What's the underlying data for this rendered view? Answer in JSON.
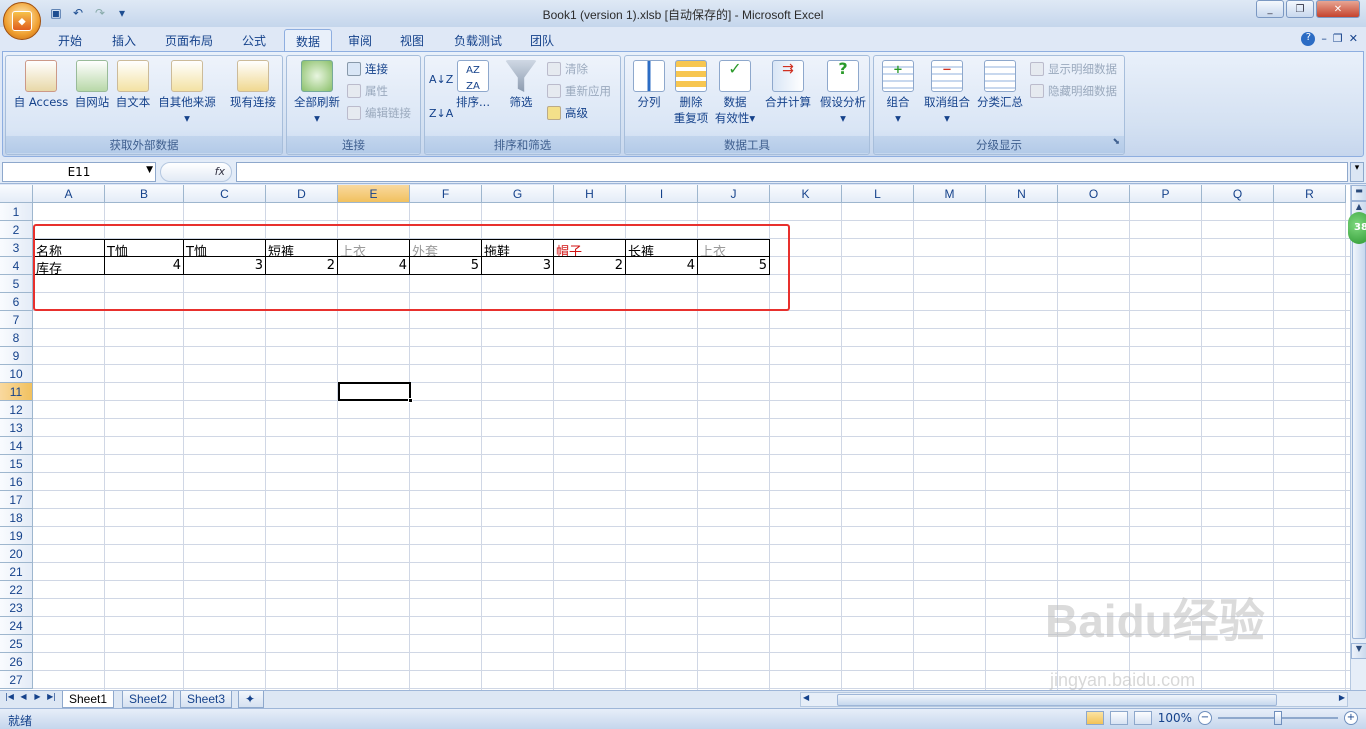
{
  "window": {
    "title": "Book1 (version 1).xlsb [自动保存的] - Microsoft Excel"
  },
  "ribbon_tabs": [
    "开始",
    "插入",
    "页面布局",
    "公式",
    "数据",
    "审阅",
    "视图",
    "负载测试",
    "团队"
  ],
  "active_tab": "数据",
  "groups": {
    "external": {
      "label": "获取外部数据",
      "buttons": [
        "自 Access",
        "自网站",
        "自文本",
        "自其他来源",
        "现有连接"
      ]
    },
    "connections": {
      "label": "连接",
      "refresh": "全部刷新",
      "small": [
        "连接",
        "属性",
        "编辑链接"
      ]
    },
    "sort": {
      "label": "排序和筛选",
      "sort_btn": "排序...",
      "filter": "筛选",
      "small": [
        "清除",
        "重新应用",
        "高级"
      ]
    },
    "tools": {
      "label": "数据工具",
      "buttons": [
        "分列",
        "删除\n重复项",
        "数据\n有效性",
        "合并计算",
        "假设分析"
      ],
      "b1": "分列",
      "b2a": "删除",
      "b2b": "重复项",
      "b3a": "数据",
      "b3b": "有效性",
      "b4": "合并计算",
      "b5": "假设分析"
    },
    "outline": {
      "label": "分级显示",
      "buttons": [
        "组合",
        "取消组合",
        "分类汇总"
      ],
      "small": [
        "显示明细数据",
        "隐藏明细数据"
      ]
    }
  },
  "formula_bar": {
    "name_box": "E11",
    "fx": "fx",
    "value": ""
  },
  "columns": [
    "A",
    "B",
    "C",
    "D",
    "E",
    "F",
    "G",
    "H",
    "I",
    "J",
    "K",
    "L",
    "M",
    "N",
    "O",
    "P",
    "Q",
    "R"
  ],
  "rows": [
    "1",
    "2",
    "3",
    "4",
    "5",
    "6",
    "7",
    "8",
    "9",
    "10",
    "11",
    "12",
    "13",
    "14",
    "15",
    "16",
    "17",
    "18",
    "19",
    "20",
    "21",
    "22",
    "23",
    "24",
    "25",
    "26",
    "27"
  ],
  "table": {
    "row3": [
      "名称",
      "T恤",
      "T恤",
      "短裤",
      "上衣",
      "外套",
      "拖鞋",
      "帽子",
      "长裤",
      "上衣"
    ],
    "row4": [
      "库存",
      "4",
      "3",
      "2",
      "4",
      "5",
      "3",
      "2",
      "4",
      "5"
    ],
    "text_colors": [
      "#000000",
      "#000000",
      "#000000",
      "#000000",
      "#9a9a9a",
      "#9a9a9a",
      "#000000",
      "#d01010",
      "#000000",
      "#9a9a9a"
    ]
  },
  "active_cell": "E11",
  "sheets": [
    "Sheet1",
    "Sheet2",
    "Sheet3"
  ],
  "active_sheet": "Sheet1",
  "status": {
    "text": "就绪",
    "zoom": "100%"
  },
  "badge": "38",
  "watermark": {
    "main": "Baidu经验",
    "url": "jingyan.baidu.com"
  }
}
